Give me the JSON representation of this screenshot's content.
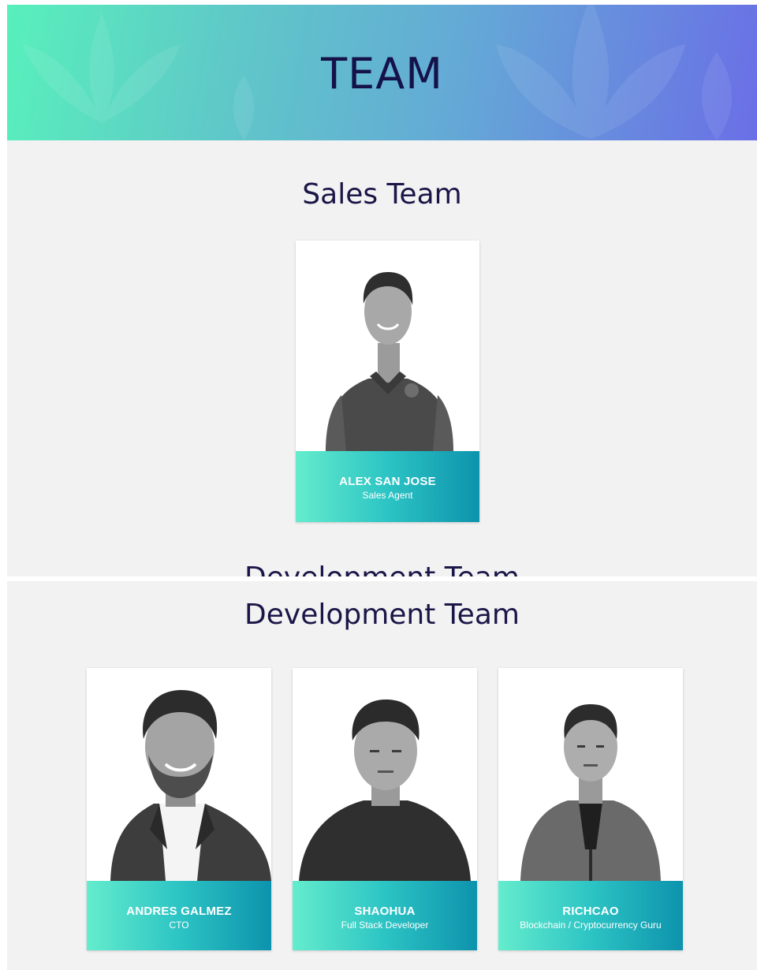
{
  "hero": {
    "title": "TEAM"
  },
  "sections": {
    "sales": {
      "title": "Sales Team",
      "members": [
        {
          "name": "ALEX SAN JOSE",
          "role": "Sales Agent"
        }
      ]
    },
    "peek": {
      "title": "Development Team"
    },
    "development": {
      "title": "Development Team",
      "members": [
        {
          "name": "ANDRES GALMEZ",
          "role": "CTO"
        },
        {
          "name": "SHAOHUA",
          "role": "Full Stack Developer"
        },
        {
          "name": "RICHCAO",
          "role": "Blockchain / Cryptocurrency Guru"
        }
      ]
    }
  },
  "colors": {
    "hero_gradient_start": "#58f0bb",
    "hero_gradient_end": "#6a6fe6",
    "title_text": "#15124a",
    "caption_gradient_start": "#64eccd",
    "caption_gradient_end": "#0d93ad",
    "section_background": "#f2f2f2"
  }
}
